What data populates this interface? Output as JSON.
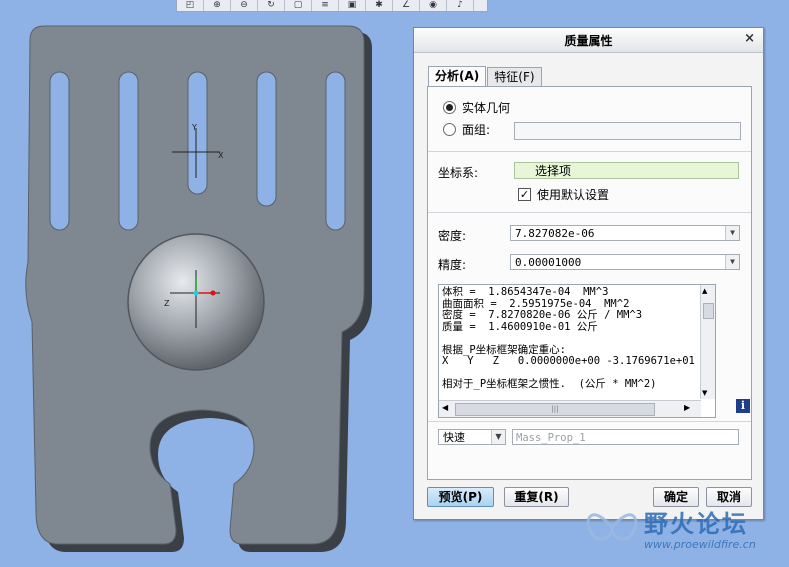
{
  "dialog": {
    "title": "质量属性",
    "close_symbol": "×",
    "tabs": [
      {
        "label": "分析(A)"
      },
      {
        "label": "特征(F)"
      }
    ],
    "geometry_options": {
      "solid_label": "实体几何",
      "surface_label": "面组:",
      "surface_value": ""
    },
    "coordinate_system": {
      "label": "坐标系:",
      "value": "选择项",
      "use_default_label": "使用默认设置",
      "use_default_checked": true
    },
    "density": {
      "label": "密度:",
      "value": "7.827082e-06"
    },
    "accuracy": {
      "label": "精度:",
      "value": "0.00001000"
    },
    "results_text": "体积 =  1.8654347e-04  MM^3\n曲面面积 =  2.5951975e-04  MM^2\n密度 =  7.8270820e-06 公斤 / MM^3\n质量 =  1.4600910e-01 公斤\n\n根据_P坐标框架确定重心:\nX   Y   Z   0.0000000e+00 -3.1769671e+01  4\n\n相对于_P坐标框架之惯性.  (公斤 * MM^2)",
    "hscroll_grip": "|||",
    "info_icon": "i",
    "mode": {
      "value": "快速",
      "name_placeholder": "Mass_Prop_1"
    },
    "buttons": {
      "preview": "预览(P)",
      "repeat": "重复(R)",
      "ok": "确定",
      "cancel": "取消"
    }
  },
  "toolbar": {
    "icons": [
      "zoom-window-icon",
      "zoom-in-icon",
      "zoom-out-icon",
      "reorient-icon",
      "saved-views-icon",
      "layers-icon",
      "camera-icon",
      "spin-center-icon",
      "datum-display-icon",
      "visibility-icon",
      "sketch-icon"
    ]
  },
  "watermark": {
    "text": "野火论坛",
    "url": "www.proewildfire.cn"
  },
  "model": {
    "axis_y": "Y",
    "axis_x": "X",
    "axis_z": "Z"
  },
  "colors": {
    "background": "#8fb2e6",
    "part_gray": "#7f8791",
    "primary_button": "#a9d2f1",
    "highlight_field": "#e6f6d6"
  }
}
